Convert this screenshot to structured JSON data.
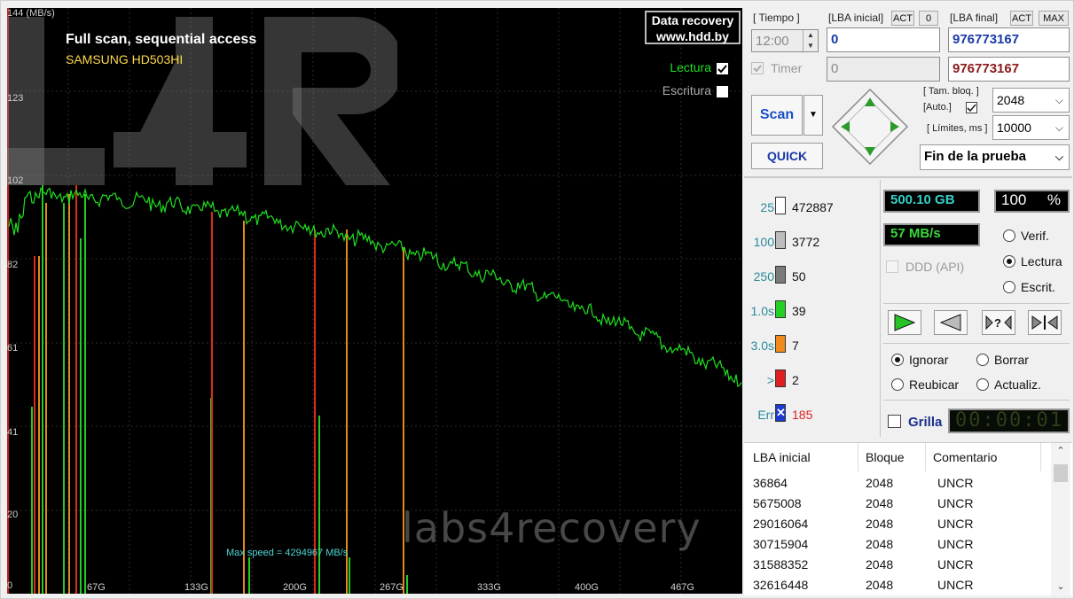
{
  "graph": {
    "y_unit_label": "144 (MB/s)",
    "y_ticks": [
      "123",
      "102",
      "82",
      "61",
      "41",
      "20",
      "0"
    ],
    "x_ticks": [
      "67G",
      "133G",
      "200G",
      "267G",
      "333G",
      "400G",
      "467G"
    ],
    "title": "Full scan, sequential access",
    "model": "SAMSUNG HD503HI",
    "brand_line1": "Data recovery",
    "brand_line2": "www.hdd.by",
    "read_label": "Lectura",
    "write_label": "Escritura",
    "read_checked": true,
    "write_checked": false,
    "max_speed": "Max speed = 4294967 MB/s",
    "watermark_text": "labs4recovery",
    "line_color": "#1fe01f",
    "bad_colors": {
      "green": "#22cc22",
      "orange": "#e08a1a",
      "red": "#dd2a1a"
    }
  },
  "controls": {
    "tiempo_label": "[ Tiempo ]",
    "tiempo_value": "12:00",
    "timer_label": "Timer",
    "lba_inicial_label": "[LBA inicial]",
    "act_label": "ACT",
    "zero_label": "0",
    "lba_inicial_value": "0",
    "lba_inicial_secondary": "0",
    "lba_final_label": "[LBA final]",
    "max_label": "MAX",
    "lba_final_value": "976773167",
    "lba_final_secondary": "976773167",
    "scan_label": "Scan",
    "quick_label": "QUICK",
    "tam_bloq_label": "[ Tam. bloq. ]",
    "auto_label": "[Auto.]",
    "block_size": "2048",
    "limites_label": "[ Límites, ms ]",
    "limit_ms": "10000",
    "end_action": "Fin de la prueba"
  },
  "stats": {
    "blocks": [
      {
        "label": "25",
        "count": "472887",
        "color": "#ffffff"
      },
      {
        "label": "100",
        "count": "3772",
        "color": "#bdbdbd"
      },
      {
        "label": "250",
        "count": "50",
        "color": "#7a7a7a"
      },
      {
        "label": "1.0s",
        "count": "39",
        "color": "#25d025"
      },
      {
        "label": "3.0s",
        "count": "7",
        "color": "#f08a1c"
      },
      {
        "label": ">",
        "count": "2",
        "color": "#e02020"
      }
    ],
    "err_label": "Err",
    "err_count": "185",
    "capacity": "500.10 GB",
    "percent": "100",
    "percent_sign": "%",
    "speed": "57 MB/s",
    "ddd_label": "DDD (API)",
    "mode_verif": "Verif.",
    "mode_lectura": "Lectura",
    "mode_escrit": "Escrit.",
    "opt_ignorar": "Ignorar",
    "opt_borrar": "Borrar",
    "opt_reubicar": "Reubicar",
    "opt_actualiz": "Actualiz.",
    "grilla_label": "Grilla",
    "elapsed": "00:00:01"
  },
  "table": {
    "headers": [
      "LBA inicial",
      "Bloque",
      "Comentario"
    ],
    "rows": [
      [
        "36864",
        "2048",
        "UNCR"
      ],
      [
        "5675008",
        "2048",
        "UNCR"
      ],
      [
        "29016064",
        "2048",
        "UNCR"
      ],
      [
        "30715904",
        "2048",
        "UNCR"
      ],
      [
        "31588352",
        "2048",
        "UNCR"
      ],
      [
        "32616448",
        "2048",
        "UNCR"
      ]
    ]
  }
}
